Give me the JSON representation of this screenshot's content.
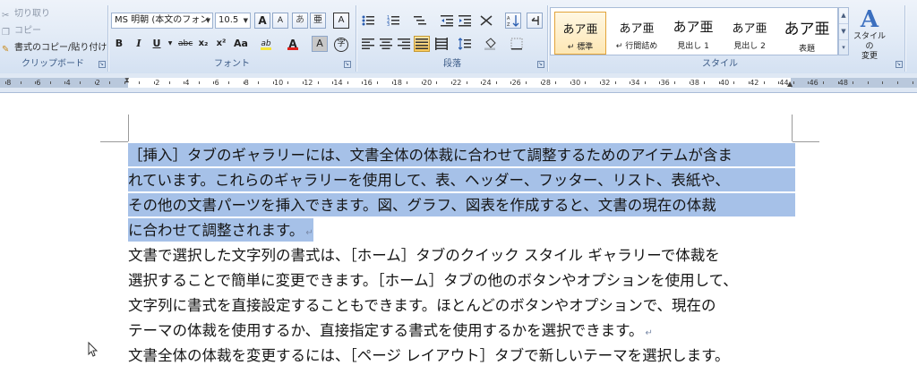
{
  "ribbon": {
    "clipboard": {
      "cut_label": "切り取り",
      "copy_label": "コピー",
      "format_painter_label": "書式のコピー/貼り付け",
      "group_label": "クリップボード"
    },
    "font": {
      "font_name": "MS 明朝 (本文のフォン",
      "font_size": "10.5",
      "group_label": "フォント",
      "grow_label": "A",
      "shrink_label": "A",
      "clear_label": "あ",
      "phonetic_label": "亜",
      "bold_label": "B",
      "italic_label": "I",
      "underline_label": "U",
      "strike_label": "abc",
      "subscript_label": "x₂",
      "superscript_label": "x²",
      "case_label": "Aa",
      "highlight_label": "ab",
      "font_color_label": "A",
      "char_shading_label": "A",
      "enclose_label": "字",
      "highlight_color": "#f5e63a",
      "font_color": "#e0201b"
    },
    "paragraph": {
      "group_label": "段落"
    },
    "styles": {
      "group_label": "スタイル",
      "items": [
        {
          "sample": "あア亜",
          "name": "↵ 標準"
        },
        {
          "sample": "あア亜",
          "name": "↵ 行間詰め"
        },
        {
          "sample": "あア亜",
          "name": "見出し 1"
        },
        {
          "sample": "あア亜",
          "name": "見出し 2"
        },
        {
          "sample": "あア亜",
          "name": "表題"
        }
      ],
      "change_styles_icon": "A",
      "change_styles_label_1": "スタイルの",
      "change_styles_label_2": "変更"
    },
    "accent_color": "#e2a33a"
  },
  "ruler": {
    "left_numbers": [
      "8",
      "6",
      "4",
      "2"
    ],
    "right_numbers": [
      "2",
      "4",
      "6",
      "8",
      "10",
      "12",
      "14",
      "16",
      "18",
      "20",
      "22",
      "24",
      "26",
      "28",
      "30",
      "32",
      "34",
      "36",
      "38",
      "40",
      "42",
      "44",
      "46",
      "48"
    ]
  },
  "document": {
    "selection_color": "#a6c1e8",
    "paragraphs": [
      {
        "selected": true,
        "lines": [
          "［挿入］タブのギャラリーには、文書全体の体裁に合わせて調整するためのアイテムが含ま",
          "れています。これらのギャラリーを使用して、表、ヘッダー、フッター、リスト、表紙や、",
          "その他の文書パーツを挿入できます。図、グラフ、図表を作成すると、文書の現在の体裁",
          "に合わせて調整されます。"
        ]
      },
      {
        "selected": false,
        "lines": [
          "文書で選択した文字列の書式は、［ホーム］タブのクイック スタイル ギャラリーで体裁を",
          "選択することで簡単に変更できます。［ホーム］タブの他のボタンやオプションを使用して、",
          "文字列に書式を直接設定することもできます。ほとんどのボタンやオプションで、現在の",
          "テーマの体裁を使用するか、直接指定する書式を使用するかを選択できます。"
        ]
      },
      {
        "selected": false,
        "lines": [
          "文書全体の体裁を変更するには、［ページ レイアウト］タブで新しいテーマを選択します。"
        ]
      }
    ],
    "paragraph_mark": "↵"
  }
}
